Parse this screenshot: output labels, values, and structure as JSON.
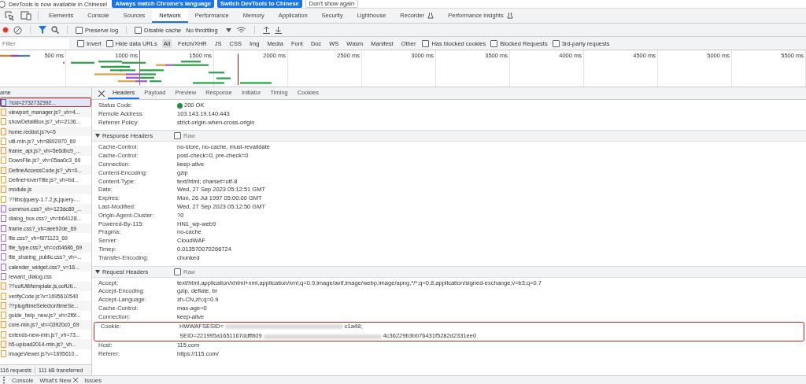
{
  "infobar": {
    "message": "DevTools is now available in Chinese!",
    "buttons": [
      {
        "label": "Always match Chrome's language",
        "kind": "primary"
      },
      {
        "label": "Switch DevTools to Chinese",
        "kind": "primary"
      },
      {
        "label": "Don't show again",
        "kind": "plain"
      }
    ]
  },
  "tabs": [
    {
      "label": "Elements",
      "selected": false
    },
    {
      "label": "Console",
      "selected": false
    },
    {
      "label": "Sources",
      "selected": false
    },
    {
      "label": "Network",
      "selected": true
    },
    {
      "label": "Performance",
      "selected": false
    },
    {
      "label": "Memory",
      "selected": false
    },
    {
      "label": "Application",
      "selected": false
    },
    {
      "label": "Security",
      "selected": false
    },
    {
      "label": "Lighthouse",
      "selected": false
    },
    {
      "label": "Recorder",
      "selected": false,
      "experimental": true
    },
    {
      "label": "Performance insights",
      "selected": false,
      "experimental": true
    }
  ],
  "toolbar": {
    "recording": true,
    "preserve_log": {
      "label": "Preserve log",
      "checked": false
    },
    "disable_cache": {
      "label": "Disable cache",
      "checked": false
    },
    "throttling": "No throttling"
  },
  "filter": {
    "placeholder": "Filter",
    "invert": {
      "label": "Invert",
      "checked": false
    },
    "hide_data_urls": {
      "label": "Hide data URLs",
      "checked": false
    },
    "types": [
      {
        "label": "All",
        "selected": true
      },
      {
        "label": "Fetch/XHR",
        "selected": false
      },
      {
        "label": "JS",
        "selected": false
      },
      {
        "label": "CSS",
        "selected": false
      },
      {
        "label": "Img",
        "selected": false
      },
      {
        "label": "Media",
        "selected": false
      },
      {
        "label": "Font",
        "selected": false
      },
      {
        "label": "Doc",
        "selected": false
      },
      {
        "label": "WS",
        "selected": false
      },
      {
        "label": "Wasm",
        "selected": false
      },
      {
        "label": "Manifest",
        "selected": false
      },
      {
        "label": "Other",
        "selected": false
      }
    ],
    "options": [
      {
        "label": "Has blocked cookies",
        "checked": false
      },
      {
        "label": "Blocked Requests",
        "checked": false
      },
      {
        "label": "3rd-party requests",
        "checked": false
      }
    ]
  },
  "overview": {
    "ticks": [
      "500 ms",
      "1000 ms",
      "1500 ms",
      "2000 ms",
      "2500 ms",
      "3000 ms",
      "3500 ms",
      "4000 ms",
      "4500 ms",
      "5000 ms",
      "5500 ms"
    ]
  },
  "requests": {
    "column": "ame",
    "items": [
      {
        "name": "?cid=2732732392...",
        "kind": "document",
        "selected": true,
        "highlighted": true
      },
      {
        "name": "viewport_manager.js?_vh=4...",
        "kind": "script",
        "selected": false,
        "highlighted": false
      },
      {
        "name": "showDetailBox.js?_vh=2136...",
        "kind": "script",
        "selected": false,
        "highlighted": false
      },
      {
        "name": "home.reddot.js?v=5",
        "kind": "script",
        "selected": false,
        "highlighted": false
      },
      {
        "name": "util-min.js?_vh=8892970_69",
        "kind": "script",
        "selected": false,
        "highlighted": false
      },
      {
        "name": "frame_api.js?_vh=5e6dbc9_...",
        "kind": "script",
        "selected": false,
        "highlighted": false
      },
      {
        "name": "DownFile.js?_vh=05aa0c3_69",
        "kind": "script",
        "selected": false,
        "highlighted": false
      },
      {
        "name": "DefineAccessCode.js?_vh=0...",
        "kind": "script",
        "selected": false,
        "highlighted": false
      },
      {
        "name": "DefineHoverTitle.js?_vh=bd...",
        "kind": "script",
        "selected": false,
        "highlighted": false
      },
      {
        "name": "module.js",
        "kind": "script",
        "selected": false,
        "highlighted": false
      },
      {
        "name": "??libs/jquery-1.7.2.js,jquery-...",
        "kind": "script",
        "selected": false,
        "highlighted": false
      },
      {
        "name": "common.css?_vh=123dc80_...",
        "kind": "stylesheet",
        "selected": false,
        "highlighted": false
      },
      {
        "name": "dialog_box.css?_vh=b64128...",
        "kind": "stylesheet",
        "selected": false,
        "highlighted": false
      },
      {
        "name": "frame.css?_vh=aee92de_69",
        "kind": "stylesheet",
        "selected": false,
        "highlighted": false
      },
      {
        "name": "file.css?_vh=f871123_69",
        "kind": "stylesheet",
        "selected": false,
        "highlighted": false
      },
      {
        "name": "file_type.css?_vh=cc64686_69",
        "kind": "stylesheet",
        "selected": false,
        "highlighted": false
      },
      {
        "name": "file_sharing_public.css?_vh=...",
        "kind": "stylesheet",
        "selected": false,
        "highlighted": false
      },
      {
        "name": "calender_widget.css?_v=16...",
        "kind": "stylesheet",
        "selected": false,
        "highlighted": false
      },
      {
        "name": "reward_dialog.css",
        "kind": "stylesheet",
        "selected": false,
        "highlighted": false
      },
      {
        "name": "??oofUtil/template.js,oofUti...",
        "kind": "script",
        "selected": false,
        "highlighted": false
      },
      {
        "name": "verifyCode.js?v=1695610540",
        "kind": "script",
        "selected": false,
        "highlighted": false
      },
      {
        "name": "??plug/timeSelector/timeSe...",
        "kind": "script",
        "selected": false,
        "highlighted": false
      },
      {
        "name": "guide_help_new.js?_vh=2f6f...",
        "kind": "script",
        "selected": false,
        "highlighted": false
      },
      {
        "name": "core-min.js?_vh=03920c0_69",
        "kind": "script",
        "selected": false,
        "highlighted": false
      },
      {
        "name": "extends-new-min.js?_vh=73...",
        "kind": "script",
        "selected": false,
        "highlighted": false
      },
      {
        "name": "h5-upload2014-min.js?_vh...",
        "kind": "script",
        "selected": false,
        "highlighted": false
      },
      {
        "name": "imageViewer.js?v=1695610...",
        "kind": "script",
        "selected": false,
        "highlighted": false
      }
    ]
  },
  "status_bar": {
    "requests": "116 requests",
    "transferred": "111 kB transferred"
  },
  "detail_tabs": [
    {
      "label": "Headers",
      "selected": true
    },
    {
      "label": "Payload",
      "selected": false
    },
    {
      "label": "Preview",
      "selected": false
    },
    {
      "label": "Response",
      "selected": false
    },
    {
      "label": "Initiator",
      "selected": false
    },
    {
      "label": "Timing",
      "selected": false
    },
    {
      "label": "Cookies",
      "selected": false
    }
  ],
  "general": [
    {
      "name": "Status Code:",
      "value": "200 OK",
      "status_ok": true
    },
    {
      "name": "Remote Address:",
      "value": "103.143.19.140:443"
    },
    {
      "name": "Referrer Policy:",
      "value": "strict-origin-when-cross-origin"
    }
  ],
  "sections": [
    {
      "title": "Response Headers",
      "raw": {
        "label": "Raw",
        "checked": false
      },
      "rows": [
        {
          "name": "Cache-Control:",
          "value": "no-store, no-cache, must-revalidate"
        },
        {
          "name": "Cache-Control:",
          "value": "post-check=0, pre-check=0"
        },
        {
          "name": "Connection:",
          "value": "keep-alive"
        },
        {
          "name": "Content-Encoding:",
          "value": "gzip"
        },
        {
          "name": "Content-Type:",
          "value": "text/html; charset=utf-8"
        },
        {
          "name": "Date:",
          "value": "Wed, 27 Sep 2023 05:12:51 GMT"
        },
        {
          "name": "Expires:",
          "value": "Mon, 26 Jul 1997 05:00:00 GMT"
        },
        {
          "name": "Last-Modified:",
          "value": "Wed, 27 Sep 2023 05:12:50 GMT"
        },
        {
          "name": "Origin-Agent-Cluster:",
          "value": "?0"
        },
        {
          "name": "Powered-By-115:",
          "value": "HN1_wp-web9"
        },
        {
          "name": "Pragma:",
          "value": "no-cache"
        },
        {
          "name": "Server:",
          "value": "CloudWAF"
        },
        {
          "name": "Timep:",
          "value": "0.013570070266724"
        },
        {
          "name": "Transfer-Encoding:",
          "value": "chunked"
        }
      ]
    },
    {
      "title": "Request Headers",
      "raw": {
        "label": "Raw",
        "checked": false
      },
      "rows": [
        {
          "name": "Accept:",
          "value": "text/html,application/xhtml+xml,application/xml;q=0.9,image/avif,image/webp,image/apng,*/*;q=0.8,application/signed-exchange;v=b3;q=0.7"
        },
        {
          "name": "Accept-Encoding:",
          "value": "gzip, deflate, br"
        },
        {
          "name": "Accept-Language:",
          "value": "zh-CN,zh;q=0.9"
        },
        {
          "name": "Cache-Control:",
          "value": "max-age=0"
        },
        {
          "name": "Connection:",
          "value": "keep-alive"
        },
        {
          "name": "Cookie:",
          "highlighted": true,
          "lines": [
            {
              "start": "HWWAFSESID=",
              "end": "c1a48;"
            },
            {
              "start": "SEID=221995a1651167ddff809",
              "end": "4c36229b3bb76431f5282d2331ee0"
            }
          ]
        },
        {
          "name": "Host:",
          "value": "115.com"
        },
        {
          "name": "Referer:",
          "value": "https://115.com/"
        }
      ]
    }
  ],
  "drawer_tabs": [
    {
      "label": "Console",
      "closable": false
    },
    {
      "label": "What's New",
      "closable": true
    },
    {
      "label": "Issues",
      "closable": false
    }
  ]
}
